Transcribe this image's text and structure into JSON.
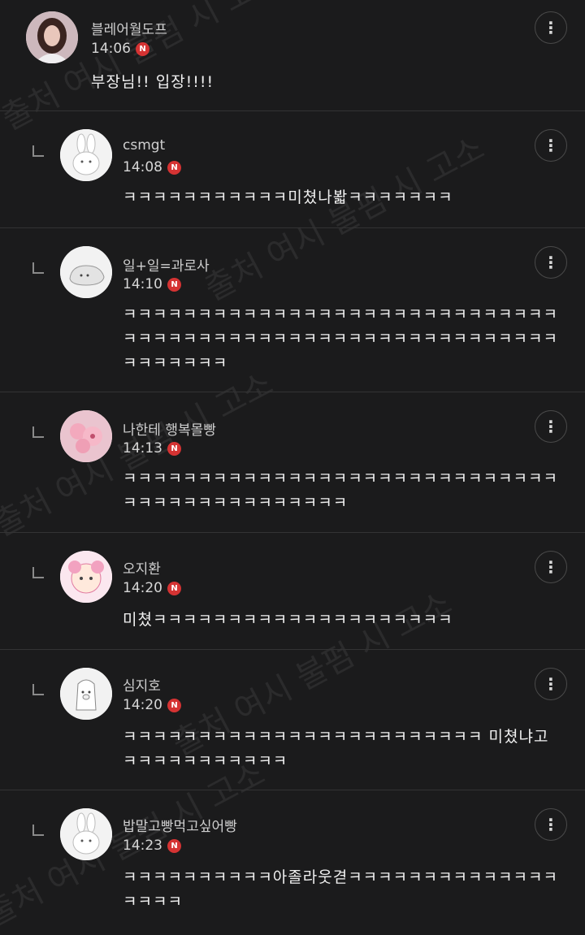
{
  "watermark_text": "출처 여시 불펌 시 고소",
  "comments": [
    {
      "author": "블레어월도프",
      "time": "14:06",
      "badge": "N",
      "text": "부장님!! 입장!!!!",
      "reply": false,
      "avatar": "profile-photo"
    },
    {
      "author": "csmgt",
      "time": "14:08",
      "badge": "N",
      "text": "ㅋㅋㅋㅋㅋㅋㅋㅋㅋㅋㅋ미쳤나봛ㅋㅋㅋㅋㅋㅋㅋ",
      "reply": true,
      "avatar": "rabbit-avatar"
    },
    {
      "author": "일+일=과로사",
      "time": "14:10",
      "badge": "N",
      "text": "ㅋㅋㅋㅋㅋㅋㅋㅋㅋㅋㅋㅋㅋㅋㅋㅋㅋㅋㅋㅋㅋㅋㅋㅋㅋㅋㅋㅋㅋㅋㅋㅋㅋㅋㅋㅋㅋㅋㅋㅋㅋㅋㅋㅋㅋㅋㅋㅋㅋㅋㅋㅋㅋㅋㅋㅋㅋㅋㅋㅋㅋㅋㅋㅋㅋ",
      "reply": true,
      "avatar": "blob-avatar"
    },
    {
      "author": "나한테 행복몰빵",
      "time": "14:13",
      "badge": "N",
      "text": "ㅋㅋㅋㅋㅋㅋㅋㅋㅋㅋㅋㅋㅋㅋㅋㅋㅋㅋㅋㅋㅋㅋㅋㅋㅋㅋㅋㅋㅋㅋㅋㅋㅋㅋㅋㅋㅋㅋㅋㅋㅋㅋㅋㅋ",
      "reply": true,
      "avatar": "flower-avatar"
    },
    {
      "author": "오지환",
      "time": "14:20",
      "badge": "N",
      "text": "미쳤ㅋㅋㅋㅋㅋㅋㅋㅋㅋㅋㅋㅋㅋㅋㅋㅋㅋㅋㅋㅋ",
      "reply": true,
      "avatar": "character-avatar"
    },
    {
      "author": "심지호",
      "time": "14:20",
      "badge": "N",
      "text": "ㅋㅋㅋㅋㅋㅋㅋㅋㅋㅋㅋㅋㅋㅋㅋㅋㅋㅋㅋㅋㅋㅋㅋㅋ 미쳤냐고 ㅋㅋㅋㅋㅋㅋㅋㅋㅋㅋㅋ",
      "reply": true,
      "avatar": "pig-avatar"
    },
    {
      "author": "밥말고빵먹고싶어빵",
      "time": "14:23",
      "badge": "N",
      "text": "ㅋㅋㅋㅋㅋㅋㅋㅋㅋㅋ아졸라웃겯ㅋㅋㅋㅋㅋㅋㅋㅋㅋㅋㅋㅋㅋㅋㅋㅋㅋㅋ",
      "reply": true,
      "avatar": "rabbit-avatar"
    }
  ]
}
